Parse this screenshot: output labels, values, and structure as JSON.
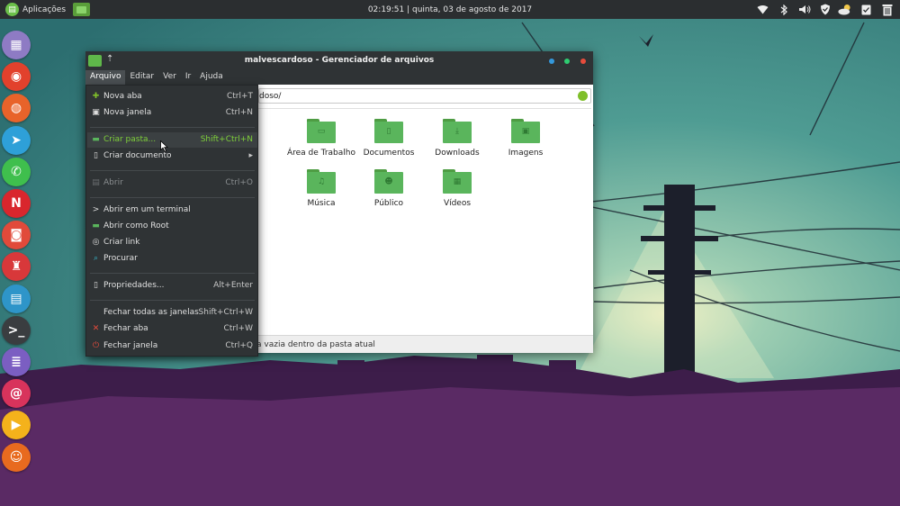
{
  "panel": {
    "apps_label": "Aplicações",
    "clock": "02:19:51  |  quinta, 03 de agosto de 2017",
    "tray_icons": [
      "wifi-icon",
      "bluetooth-icon",
      "volume-icon",
      "shield-icon",
      "weather-icon",
      "clipboard-icon",
      "trash-icon"
    ]
  },
  "dock": {
    "apps": [
      {
        "name": "dock-app-launcher",
        "color": "#8e7bc4",
        "glyph": "▦"
      },
      {
        "name": "dock-chrome",
        "color": "#e2412c",
        "glyph": "◉"
      },
      {
        "name": "dock-firefox",
        "color": "#e8632a",
        "glyph": "◍"
      },
      {
        "name": "dock-telegram",
        "color": "#2ea0d8",
        "glyph": "➤"
      },
      {
        "name": "dock-whatsapp",
        "color": "#3fbf4d",
        "glyph": "✆"
      },
      {
        "name": "dock-netflix",
        "color": "#d9262d",
        "glyph": "N"
      },
      {
        "name": "dock-camera",
        "color": "#e14a3a",
        "glyph": "◙"
      },
      {
        "name": "dock-shutter",
        "color": "#d8383a",
        "glyph": "♜"
      },
      {
        "name": "dock-archive",
        "color": "#2e95c9",
        "glyph": "▤"
      },
      {
        "name": "dock-terminal",
        "color": "#3a3d40",
        "glyph": ">_"
      },
      {
        "name": "dock-text-editor",
        "color": "#7b5ec2",
        "glyph": "≣"
      },
      {
        "name": "dock-app-red",
        "color": "#d8335c",
        "glyph": "@"
      },
      {
        "name": "dock-media-player",
        "color": "#f4b21b",
        "glyph": "▶"
      },
      {
        "name": "dock-user",
        "color": "#e86a1f",
        "glyph": "☺"
      }
    ]
  },
  "window": {
    "title": "malvescardoso - Gerenciador de arquivos",
    "menus": [
      "Arquivo",
      "Editar",
      "Ver",
      "Ir",
      "Ajuda"
    ],
    "path_visible": "doso/",
    "status_visible": "a vazia dentro da pasta atual",
    "colors": {
      "close": "#e74c3c",
      "maximize": "#2ecc71",
      "minimize": "#3498db",
      "folder": "#5ab55c"
    },
    "folders": [
      {
        "label": "Área de Trabalho",
        "emblem": "desktop-emblem-icon",
        "glyph": "▭"
      },
      {
        "label": "Documentos",
        "emblem": "document-emblem-icon",
        "glyph": "▯"
      },
      {
        "label": "Downloads",
        "emblem": "download-emblem-icon",
        "glyph": "⤓"
      },
      {
        "label": "Imagens",
        "emblem": "image-emblem-icon",
        "glyph": "▣"
      },
      {
        "label": "Música",
        "emblem": "music-emblem-icon",
        "glyph": "♫"
      },
      {
        "label": "Público",
        "emblem": "public-emblem-icon",
        "glyph": "☻"
      },
      {
        "label": "Vídeos",
        "emblem": "video-emblem-icon",
        "glyph": "▦"
      }
    ]
  },
  "file_menu": {
    "items": [
      {
        "label": "Nova aba",
        "shortcut": "Ctrl+T",
        "icon": "plus-icon",
        "icon_color": "#7fbf2a",
        "glyph": "✚"
      },
      {
        "label": "Nova janela",
        "shortcut": "Ctrl+N",
        "icon": "new-window-icon",
        "icon_color": "#dddddd",
        "glyph": "▣"
      },
      {
        "label": "Criar pasta...",
        "shortcut": "Shift+Ctrl+N",
        "icon": "folder-new-icon",
        "icon_color": "#5ab55c",
        "glyph": "▬"
      },
      {
        "label": "Criar documento",
        "shortcut": "▸",
        "icon": "document-new-icon",
        "icon_color": "#dddddd",
        "glyph": "▯"
      },
      {
        "label": "Abrir",
        "shortcut": "Ctrl+O",
        "icon": "open-icon",
        "icon_color": "#6a6e70",
        "glyph": "▤"
      },
      {
        "label": "Abrir em um terminal",
        "shortcut": "",
        "icon": "terminal-icon",
        "icon_color": "#dddddd",
        "glyph": ">"
      },
      {
        "label": "Abrir como Root",
        "shortcut": "",
        "icon": "root-icon",
        "icon_color": "#5ab55c",
        "glyph": "▬"
      },
      {
        "label": "Criar link",
        "shortcut": "",
        "icon": "link-icon",
        "icon_color": "#dddddd",
        "glyph": "◎"
      },
      {
        "label": "Procurar",
        "shortcut": "",
        "icon": "search-icon",
        "icon_color": "#36b6c9",
        "glyph": "⌕"
      },
      {
        "label": "Propriedades...",
        "shortcut": "Alt+Enter",
        "icon": "properties-icon",
        "icon_color": "#dddddd",
        "glyph": "▯"
      },
      {
        "label": "Fechar todas as janelas",
        "shortcut": "Shift+Ctrl+W",
        "icon": "",
        "icon_color": "",
        "glyph": ""
      },
      {
        "label": "Fechar aba",
        "shortcut": "Ctrl+W",
        "icon": "close-icon",
        "icon_color": "#e74c3c",
        "glyph": "✕"
      },
      {
        "label": "Fechar janela",
        "shortcut": "Ctrl+Q",
        "icon": "power-icon",
        "icon_color": "#e74c3c",
        "glyph": "⏻"
      }
    ]
  }
}
